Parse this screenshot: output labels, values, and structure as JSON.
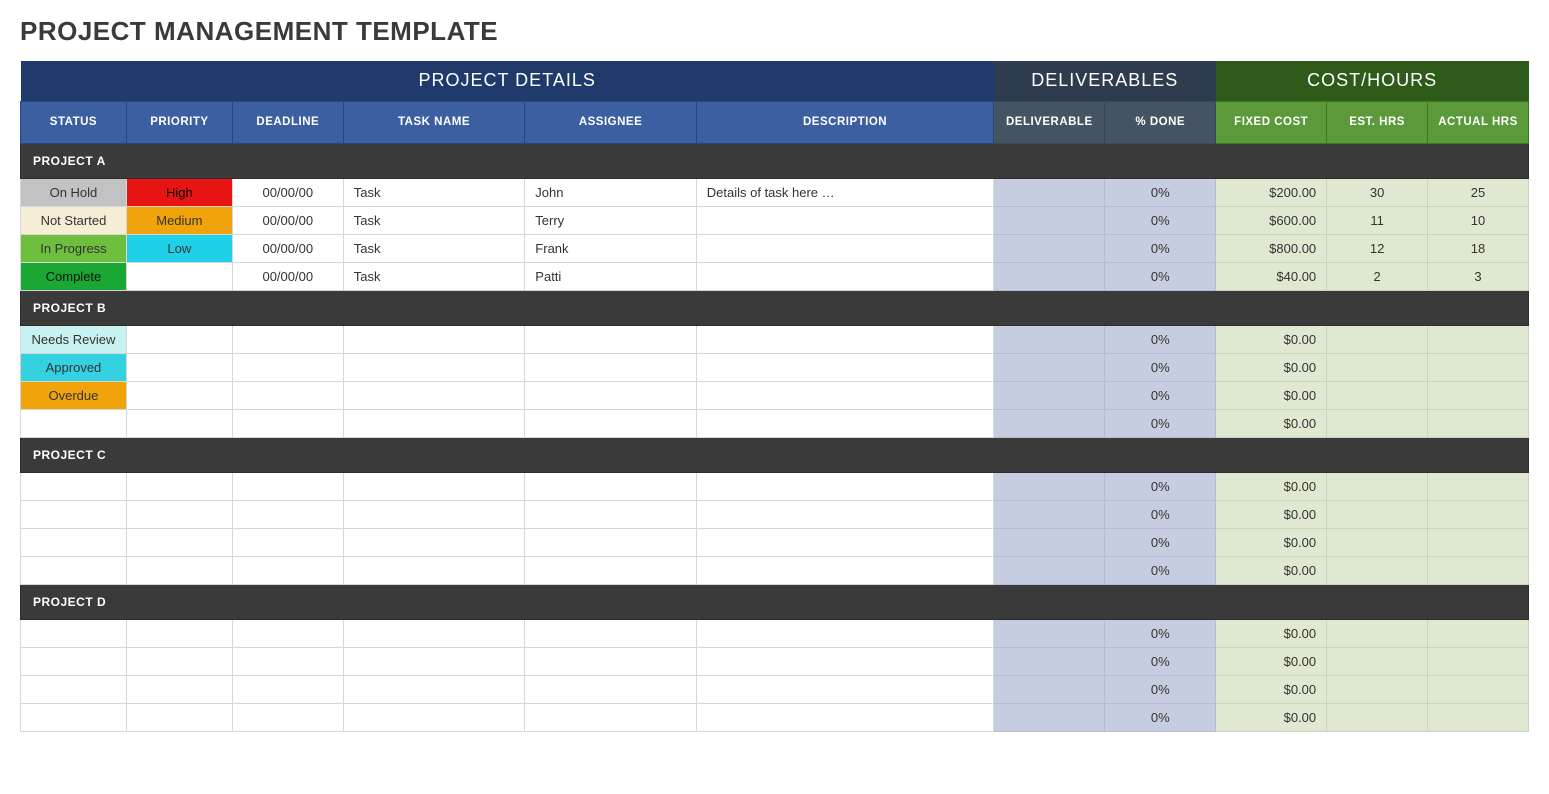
{
  "page_title": "PROJECT MANAGEMENT TEMPLATE",
  "super_headers": {
    "details": "PROJECT DETAILS",
    "deliverables": "DELIVERABLES",
    "cost_hours": "COST/HOURS"
  },
  "columns": {
    "status": "STATUS",
    "priority": "PRIORITY",
    "deadline": "DEADLINE",
    "task": "TASK NAME",
    "assignee": "ASSIGNEE",
    "description": "DESCRIPTION",
    "deliverable": "DELIVERABLE",
    "done": "% DONE",
    "fixed": "FIXED COST",
    "est": "EST. HRS",
    "actual": "ACTUAL HRS"
  },
  "status_styles": {
    "On Hold": "bg-onhold",
    "Not Started": "bg-notstarted",
    "In Progress": "bg-inprogress",
    "Complete": "bg-complete",
    "Needs Review": "bg-needsreview",
    "Approved": "bg-approved",
    "Overdue": "bg-overdue"
  },
  "priority_styles": {
    "High": "bg-high",
    "Medium": "bg-medium",
    "Low": "bg-low"
  },
  "projects": [
    {
      "name": "PROJECT A",
      "rows": [
        {
          "status": "On Hold",
          "priority": "High",
          "deadline": "00/00/00",
          "task": "Task",
          "assignee": "John",
          "description": "Details of task here …",
          "deliverable": "",
          "done": "0%",
          "fixed": "$200.00",
          "est": "30",
          "actual": "25"
        },
        {
          "status": "Not Started",
          "priority": "Medium",
          "deadline": "00/00/00",
          "task": "Task",
          "assignee": "Terry",
          "description": "",
          "deliverable": "",
          "done": "0%",
          "fixed": "$600.00",
          "est": "11",
          "actual": "10"
        },
        {
          "status": "In Progress",
          "priority": "Low",
          "deadline": "00/00/00",
          "task": "Task",
          "assignee": "Frank",
          "description": "",
          "deliverable": "",
          "done": "0%",
          "fixed": "$800.00",
          "est": "12",
          "actual": "18"
        },
        {
          "status": "Complete",
          "priority": "",
          "deadline": "00/00/00",
          "task": "Task",
          "assignee": "Patti",
          "description": "",
          "deliverable": "",
          "done": "0%",
          "fixed": "$40.00",
          "est": "2",
          "actual": "3"
        }
      ]
    },
    {
      "name": "PROJECT B",
      "rows": [
        {
          "status": "Needs Review",
          "priority": "",
          "deadline": "",
          "task": "",
          "assignee": "",
          "description": "",
          "deliverable": "",
          "done": "0%",
          "fixed": "$0.00",
          "est": "",
          "actual": ""
        },
        {
          "status": "Approved",
          "priority": "",
          "deadline": "",
          "task": "",
          "assignee": "",
          "description": "",
          "deliverable": "",
          "done": "0%",
          "fixed": "$0.00",
          "est": "",
          "actual": ""
        },
        {
          "status": "Overdue",
          "priority": "",
          "deadline": "",
          "task": "",
          "assignee": "",
          "description": "",
          "deliverable": "",
          "done": "0%",
          "fixed": "$0.00",
          "est": "",
          "actual": ""
        },
        {
          "status": "",
          "priority": "",
          "deadline": "",
          "task": "",
          "assignee": "",
          "description": "",
          "deliverable": "",
          "done": "0%",
          "fixed": "$0.00",
          "est": "",
          "actual": ""
        }
      ]
    },
    {
      "name": "PROJECT C",
      "rows": [
        {
          "status": "",
          "priority": "",
          "deadline": "",
          "task": "",
          "assignee": "",
          "description": "",
          "deliverable": "",
          "done": "0%",
          "fixed": "$0.00",
          "est": "",
          "actual": ""
        },
        {
          "status": "",
          "priority": "",
          "deadline": "",
          "task": "",
          "assignee": "",
          "description": "",
          "deliverable": "",
          "done": "0%",
          "fixed": "$0.00",
          "est": "",
          "actual": ""
        },
        {
          "status": "",
          "priority": "",
          "deadline": "",
          "task": "",
          "assignee": "",
          "description": "",
          "deliverable": "",
          "done": "0%",
          "fixed": "$0.00",
          "est": "",
          "actual": ""
        },
        {
          "status": "",
          "priority": "",
          "deadline": "",
          "task": "",
          "assignee": "",
          "description": "",
          "deliverable": "",
          "done": "0%",
          "fixed": "$0.00",
          "est": "",
          "actual": ""
        }
      ]
    },
    {
      "name": "PROJECT D",
      "rows": [
        {
          "status": "",
          "priority": "",
          "deadline": "",
          "task": "",
          "assignee": "",
          "description": "",
          "deliverable": "",
          "done": "0%",
          "fixed": "$0.00",
          "est": "",
          "actual": ""
        },
        {
          "status": "",
          "priority": "",
          "deadline": "",
          "task": "",
          "assignee": "",
          "description": "",
          "deliverable": "",
          "done": "0%",
          "fixed": "$0.00",
          "est": "",
          "actual": ""
        },
        {
          "status": "",
          "priority": "",
          "deadline": "",
          "task": "",
          "assignee": "",
          "description": "",
          "deliverable": "",
          "done": "0%",
          "fixed": "$0.00",
          "est": "",
          "actual": ""
        },
        {
          "status": "",
          "priority": "",
          "deadline": "",
          "task": "",
          "assignee": "",
          "description": "",
          "deliverable": "",
          "done": "0%",
          "fixed": "$0.00",
          "est": "",
          "actual": ""
        }
      ]
    }
  ]
}
